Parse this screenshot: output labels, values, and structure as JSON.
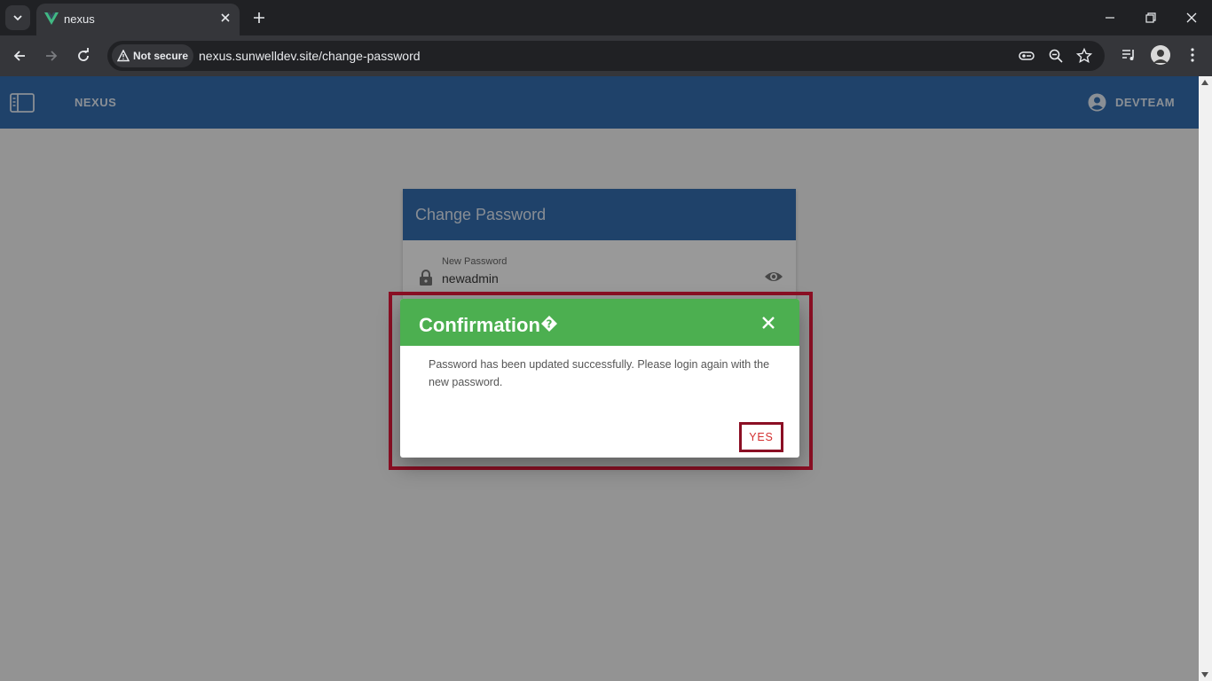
{
  "browser": {
    "tab_title": "nexus",
    "security_chip": "Not secure",
    "url": "nexus.sunwelldev.site/change-password"
  },
  "app": {
    "brand": "NEXUS",
    "user": "DEVTEAM"
  },
  "change_password": {
    "title": "Change Password",
    "new_password_label": "New Password",
    "new_password_value": "newadmin"
  },
  "dialog": {
    "title": "Confirmation",
    "message": "Password has been updated successfully. Please login again with the new password.",
    "yes_label": "YES"
  },
  "colors": {
    "app_bar": "#1e5fa8",
    "dialog_header": "#4caf50",
    "highlight": "#8b0f24",
    "yes_text": "#d32f2f"
  }
}
